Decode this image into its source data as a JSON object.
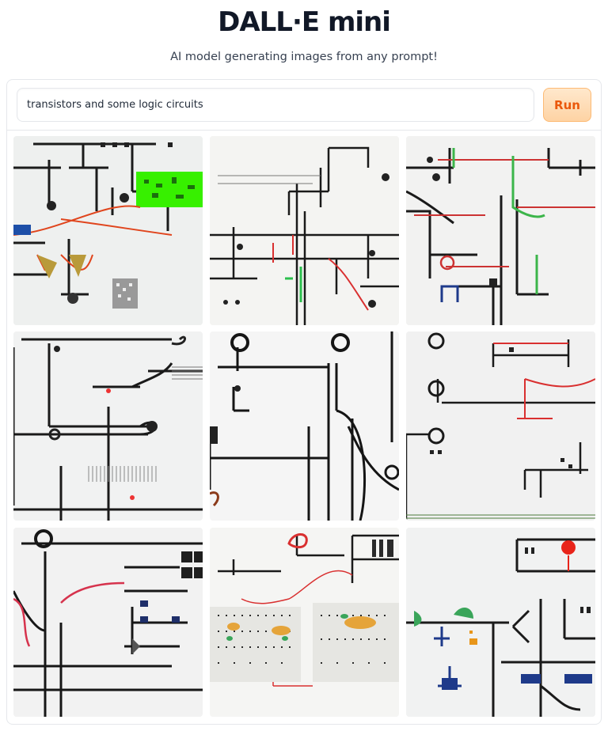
{
  "header": {
    "title": "DALL·E mini",
    "subtitle": "AI model generating images from any prompt!"
  },
  "prompt": {
    "value": "transistors and some logic circuits"
  },
  "run_button": {
    "label": "Run"
  },
  "gallery": {
    "image_count": 9,
    "subject": "generated circuit diagram sketches"
  },
  "colors": {
    "accent": "#ea580c",
    "button_bg": "#fed7aa",
    "border": "#e5e7eb",
    "title": "#111827"
  }
}
